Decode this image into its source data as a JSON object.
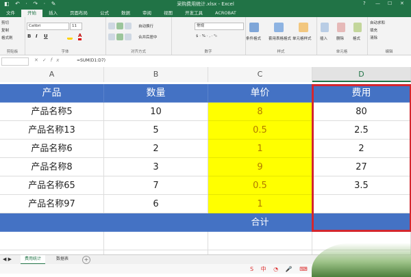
{
  "titlebar": {
    "title": "采购费用统计.xlsx - Excel",
    "qat_glyphs": "◧ ↶ · ↷ · ✎",
    "window_controls": [
      "?",
      "—",
      "☐",
      "✕"
    ]
  },
  "ribbon_tabs": [
    "文件",
    "开始",
    "插入",
    "页面布局",
    "公式",
    "数据",
    "审阅",
    "视图",
    "开发工具",
    "ACROBAT"
  ],
  "ribbon": {
    "clipboard": {
      "cut": "剪切",
      "copy": "复制",
      "format_painter": "格式刷",
      "label": "剪贴板"
    },
    "font": {
      "name": "Calibri",
      "size": "11",
      "label": "字体"
    },
    "alignment": {
      "wrap": "自动换行",
      "merge": "合并后居中",
      "label": "对齐方式"
    },
    "number": {
      "format": "常规",
      "label": "数字"
    },
    "styles": {
      "conditional": "条件格式",
      "as_table": "套用表格格式",
      "cell_styles": "单元格样式",
      "label": "样式"
    },
    "cells": {
      "insert": "插入",
      "delete": "删除",
      "format": "格式",
      "label": "单元格"
    },
    "editing": {
      "autosum": "自动求和",
      "fill": "填充",
      "clear": "清除",
      "label": "编辑"
    }
  },
  "formula_bar": {
    "name_box": "",
    "formula": "=SUM(D1:D7)"
  },
  "columns": [
    "A",
    "B",
    "C",
    "D"
  ],
  "table": {
    "headers": [
      "产品",
      "数量",
      "单价",
      "费用"
    ],
    "rows": [
      [
        "产品名称5",
        "10",
        "8",
        "80"
      ],
      [
        "产品名称13",
        "5",
        "0.5",
        "2.5"
      ],
      [
        "产品名称6",
        "2",
        "1",
        "2"
      ],
      [
        "产品名称8",
        "3",
        "9",
        "27"
      ],
      [
        "产品名称65",
        "7",
        "0.5",
        "3.5"
      ],
      [
        "产品名称97",
        "6",
        "1",
        ""
      ]
    ],
    "total_label": "合计"
  },
  "sheets": [
    "费用统计",
    "数据表"
  ],
  "add_sheet": "+",
  "ime_glyphs": "S 中 ◔ 🎤 ⌨ ⚙",
  "colors": {
    "excel_green": "#217346",
    "header_blue": "#4472c4",
    "highlight_yellow": "#ffff00",
    "selection_red": "#d4262e"
  }
}
